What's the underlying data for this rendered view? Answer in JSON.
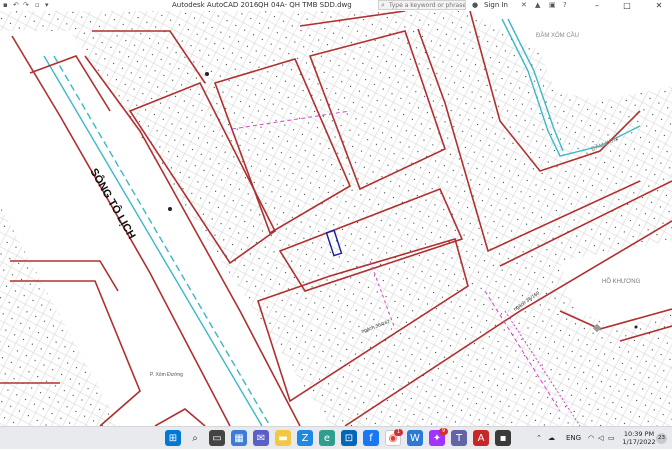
{
  "window": {
    "app_title": "Autodesk AutoCAD 2016",
    "doc_title": "QH 04A- QH TMB SDD.dwg",
    "search_placeholder": "Type a keyword or phrase",
    "sign_in": "Sign In",
    "help": "?",
    "minimize": "–",
    "maximize": "□",
    "close": "✕"
  },
  "map": {
    "river_label": "SÔNG TÔ LỊCH",
    "lake_north": "ĐẦM XÓM CẦU",
    "lake_north_right": "ĐẦM XÓM",
    "lake_east": "HỒ KHƯƠNG",
    "lane_1": "ngách 36/167",
    "lane_2": "ngách 36/169",
    "ward_label": "P. Xóm Đường",
    "colors": {
      "road_outline": "#b03030",
      "river_line": "#3cb8c8",
      "lane_line": "#d048c8",
      "parcel": "#c4c4c4",
      "selection": "#1a1aa0"
    }
  },
  "taskbar": {
    "badge_facebook": "1",
    "badge_messenger": "9",
    "lang": "ENG",
    "time": "10:39 PM",
    "date": "1/17/2022",
    "notifications": "23"
  }
}
